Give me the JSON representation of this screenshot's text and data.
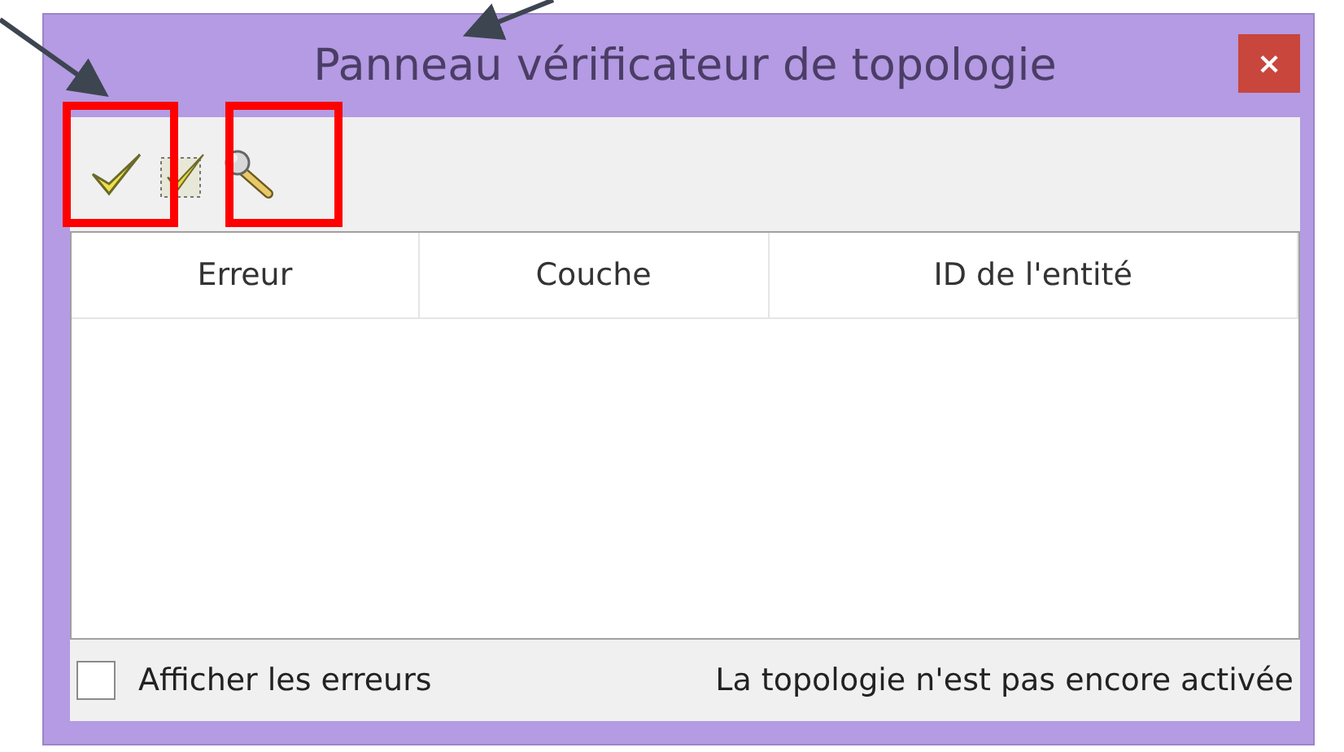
{
  "window": {
    "title": "Panneau vérificateur de topologie",
    "close_label": "×"
  },
  "toolbar": [
    {
      "kind": "validate-all"
    },
    {
      "kind": "validate-extent"
    },
    {
      "kind": "configure"
    }
  ],
  "table": {
    "columns": [
      "Erreur",
      "Couche",
      "ID de l'entité"
    ]
  },
  "footer": {
    "show_errors": {
      "label": "Afficher les erreurs",
      "checked": false
    },
    "status": "La topologie n'est pas encore activée"
  }
}
